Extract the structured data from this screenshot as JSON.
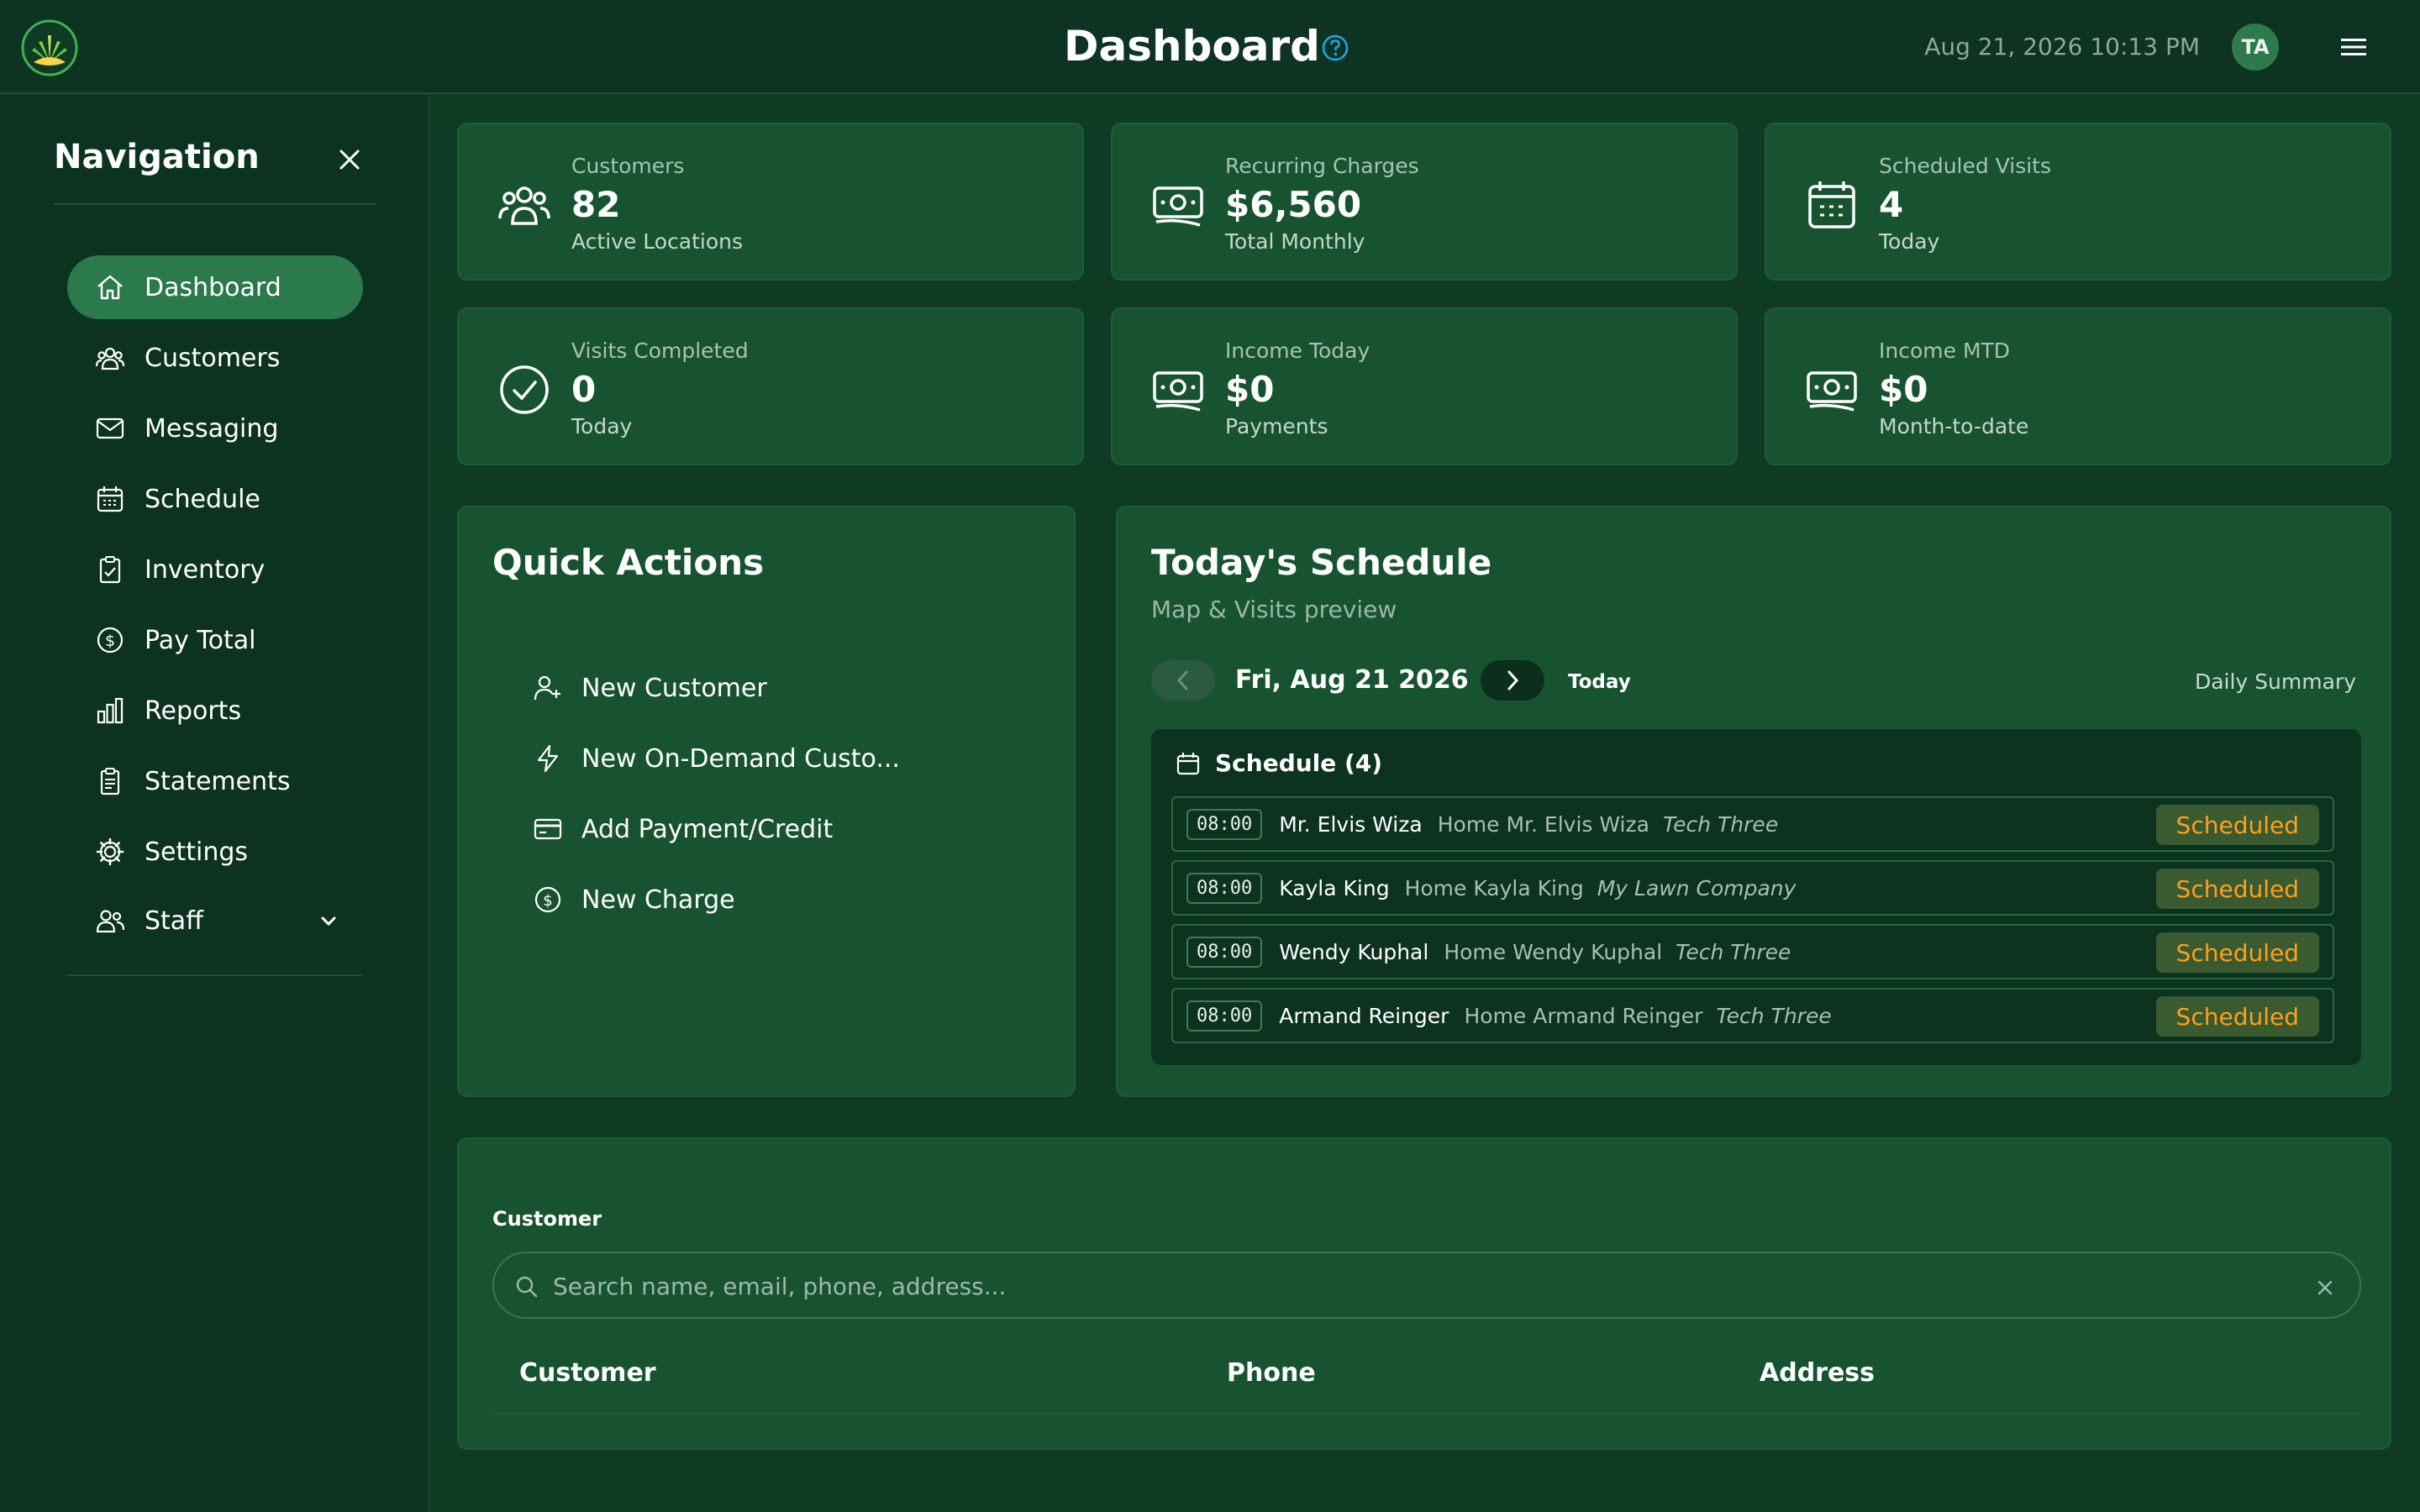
{
  "header": {
    "title": "Dashboard",
    "datetime": "Aug 21, 2026 10:13 PM",
    "avatar_initials": "TA",
    "icons": {
      "logo": "leaf-logo",
      "help": "help-circle-icon",
      "menu": "hamburger-menu-icon"
    }
  },
  "sidebar": {
    "title": "Navigation",
    "items": [
      {
        "label": "Dashboard",
        "icon": "home-icon",
        "active": true
      },
      {
        "label": "Customers",
        "icon": "users-icon"
      },
      {
        "label": "Messaging",
        "icon": "envelope-icon"
      },
      {
        "label": "Schedule",
        "icon": "calendar-icon"
      },
      {
        "label": "Inventory",
        "icon": "clipboard-check-icon"
      },
      {
        "label": "Pay Total",
        "icon": "dollar-circle-icon"
      },
      {
        "label": "Reports",
        "icon": "bar-chart-icon"
      },
      {
        "label": "Statements",
        "icon": "documents-icon"
      },
      {
        "label": "Settings",
        "icon": "gear-icon"
      },
      {
        "label": "Staff",
        "icon": "people-icon",
        "expandable": true
      }
    ]
  },
  "stats": [
    {
      "label": "Customers",
      "value": "82",
      "sub": "Active Locations",
      "icon": "users-icon"
    },
    {
      "label": "Recurring Charges",
      "value": "$6,560",
      "sub": "Total Monthly",
      "icon": "money-icon"
    },
    {
      "label": "Scheduled Visits",
      "value": "4",
      "sub": "Today",
      "icon": "calendar-icon"
    },
    {
      "label": "Visits Completed",
      "value": "0",
      "sub": "Today",
      "icon": "check-circle-icon"
    },
    {
      "label": "Income Today",
      "value": "$0",
      "sub": "Payments",
      "icon": "money-icon"
    },
    {
      "label": "Income MTD",
      "value": "$0",
      "sub": "Month-to-date",
      "icon": "money-icon"
    }
  ],
  "quick_actions": {
    "title": "Quick Actions",
    "items": [
      {
        "label": "New Customer",
        "icon": "user-plus-icon"
      },
      {
        "label": "New On-Demand Custo...",
        "icon": "lightning-icon"
      },
      {
        "label": "Add Payment/Credit",
        "icon": "credit-card-icon"
      },
      {
        "label": "New Charge",
        "icon": "dollar-circle-icon"
      }
    ]
  },
  "schedule": {
    "title": "Today's Schedule",
    "subtitle": "Map & Visits preview",
    "date": "Fri, Aug 21 2026",
    "today_label": "Today",
    "daily_summary_label": "Daily Summary",
    "list_title": "Schedule (4)",
    "rows": [
      {
        "time": "08:00",
        "name": "Mr. Elvis Wiza",
        "location": "Home Mr. Elvis Wiza",
        "tech": "Tech Three",
        "status": "Scheduled"
      },
      {
        "time": "08:00",
        "name": "Kayla King",
        "location": "Home Kayla King",
        "tech": "My Lawn Company",
        "status": "Scheduled"
      },
      {
        "time": "08:00",
        "name": "Wendy Kuphal",
        "location": "Home Wendy Kuphal",
        "tech": "Tech Three",
        "status": "Scheduled"
      },
      {
        "time": "08:00",
        "name": "Armand Reinger",
        "location": "Home Armand Reinger",
        "tech": "Tech Three",
        "status": "Scheduled"
      }
    ]
  },
  "customer_search": {
    "label": "Customer",
    "placeholder": "Search name, email, phone, address...",
    "value": "",
    "columns": [
      "Customer",
      "Phone",
      "Address"
    ]
  },
  "colors": {
    "background": "#0f3a24",
    "card": "#185331",
    "active_nav": "#2a7a4b",
    "status_text": "#ff9f1a",
    "help_icon": "#1ea7e4"
  }
}
